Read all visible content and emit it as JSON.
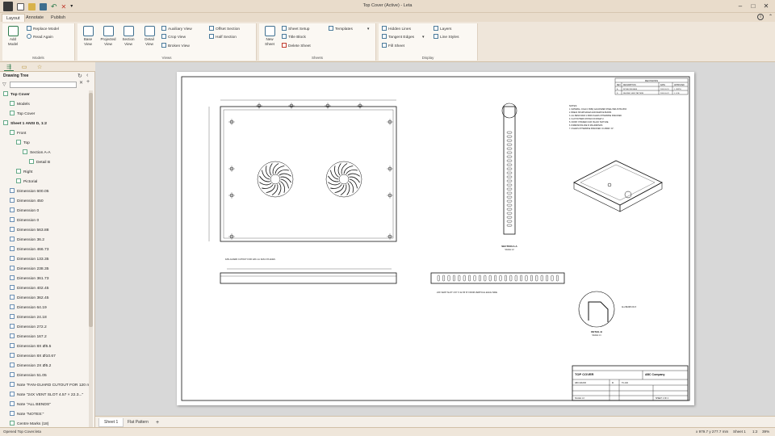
{
  "window": {
    "title": "Top Cover (Active) - Leta",
    "minimize": "–",
    "maximize": "□",
    "close": "✕"
  },
  "menu_tabs": [
    "Layout",
    "Annotate",
    "Publish"
  ],
  "ribbon": {
    "groups": {
      "models": "Models",
      "views": "Views",
      "sheets": "Sheets",
      "display": "Display"
    },
    "models": {
      "add_model": "Add\nModel",
      "replace_model": "Replace Model",
      "read_again": "Read Again"
    },
    "views": {
      "base_view": "Base\nView",
      "projected_view": "Projected\nView",
      "section_view": "Section\nView",
      "detail_view": "Detail\nView",
      "auxiliary_view": "Auxiliary View",
      "crop_view": "Crop View",
      "broken_view": "Broken View",
      "offset_section": "Offset Section",
      "half_section": "Half Section"
    },
    "sheets": {
      "new_sheet": "New\nSheet",
      "sheet_setup": "Sheet Setup",
      "title_block": "Title Block",
      "delete_sheet": "Delete Sheet",
      "templates": "Templates"
    },
    "display": {
      "hidden_lines": "Hidden Lines",
      "tangent_edges": "Tangent Edges",
      "fill_sheet": "Fill Sheet",
      "layers": "Layers",
      "line_styles": "Line Styles"
    }
  },
  "sidebar": {
    "header": "Drawing Tree",
    "tree": [
      {
        "label": "Top Cover",
        "indent": 0,
        "bold": true
      },
      {
        "label": "Models",
        "indent": 1,
        "bold": false
      },
      {
        "label": "Top Cover",
        "indent": 1,
        "bold": false
      },
      {
        "label": "Sheet 1   ANSI D, 1:2",
        "indent": 0,
        "bold": true
      },
      {
        "label": "Front",
        "indent": 1,
        "bold": false
      },
      {
        "label": "Top",
        "indent": 2,
        "bold": false
      },
      {
        "label": "Section A-A",
        "indent": 3,
        "bold": false
      },
      {
        "label": "Detail B",
        "indent": 4,
        "bold": false
      },
      {
        "label": "Right",
        "indent": 2,
        "bold": false
      },
      {
        "label": "Pictorial",
        "indent": 2,
        "bold": false
      },
      {
        "label": "Dimension 600.05",
        "indent": 1,
        "bold": false
      },
      {
        "label": "Dimension 450",
        "indent": 1,
        "bold": false
      },
      {
        "label": "Dimension 0",
        "indent": 1,
        "bold": false
      },
      {
        "label": "Dimension 0",
        "indent": 1,
        "bold": false
      },
      {
        "label": "Dimension 563.88",
        "indent": 1,
        "bold": false
      },
      {
        "label": "Dimension 36.2",
        "indent": 1,
        "bold": false
      },
      {
        "label": "Dimension 466.73",
        "indent": 1,
        "bold": false
      },
      {
        "label": "Dimension 133.35",
        "indent": 1,
        "bold": false
      },
      {
        "label": "Dimension 238.35",
        "indent": 1,
        "bold": false
      },
      {
        "label": "Dimension 361.73",
        "indent": 1,
        "bold": false
      },
      {
        "label": "Dimension 402.45",
        "indent": 1,
        "bold": false
      },
      {
        "label": "Dimension 362.45",
        "indent": 1,
        "bold": false
      },
      {
        "label": "Dimension 64.19",
        "indent": 1,
        "bold": false
      },
      {
        "label": "Dimension 24.18",
        "indent": 1,
        "bold": false
      },
      {
        "label": "Dimension 272.2",
        "indent": 1,
        "bold": false
      },
      {
        "label": "Dimension 167.2",
        "indent": 1,
        "bold": false
      },
      {
        "label": "Dimension 8X Ø5.5",
        "indent": 1,
        "bold": false
      },
      {
        "label": "Dimension 8X Ø10.67",
        "indent": 1,
        "bold": false
      },
      {
        "label": "Dimension 2X Ø5.2",
        "indent": 1,
        "bold": false
      },
      {
        "label": "Dimension 51.05",
        "indent": 1,
        "bold": false
      },
      {
        "label": "Note \"FAN-GUARD CUTOUT FOR 120 m...",
        "indent": 1,
        "bold": false
      },
      {
        "label": "Note \"24X VENT SLOT 4.57 × 22.3...\"",
        "indent": 1,
        "bold": false
      },
      {
        "label": "Note \"ALL BENDS\"",
        "indent": 1,
        "bold": false
      },
      {
        "label": "Note \"NOTES:\"",
        "indent": 1,
        "bold": false
      },
      {
        "label": "Centre Marks (18)",
        "indent": 1,
        "bold": false
      }
    ]
  },
  "drawing": {
    "revisions_title": "REVISIONS",
    "rev_headers": [
      "REV",
      "DESCRIPTION",
      "DATE",
      "APPROVED"
    ],
    "rev_rows": [
      [
        "A",
        "INITIAL RELEASE",
        "2020-10-15",
        "J. SMITH"
      ],
      [
        "B",
        "REVISED VENT PATTERN",
        "2020-10-22",
        "J. DOE"
      ]
    ],
    "notes_title": "NOTES:",
    "notes": [
      "1. MATERIAL: 16GA (1.5MM) GALVANIZED STEEL PER ASTM A653.",
      "2. BREAK SHARP EDGES AND REMOVE BURRS.",
      "3. ALL BEND RADII 1.5MM UNLESS OTHERWISE SPECIFIED.",
      "4. FLAT PATTERN SHOWN ON SHEET 2.",
      "5. FINISH: POWDER COAT, BLACK TEXTURE.",
      "6. DIMENSIONS ARE IN MILLIMETERS.",
      "7. UNLESS OTHERWISE SPECIFIED: ±0.25MM / ±1°."
    ],
    "fan_note": "FAN-GUARD CUTOUT FOR 120 mm FAN 2 PLACES",
    "vent_note": "24X VENT SLOT 4.57 X 22.35 'R' FROM VERTICAL EACH SIDE",
    "bends_note": "ALL BENDS R1.5",
    "section_label": "SECTION A-A",
    "section_scale": "SCALE 1:2",
    "detail_label": "DETAIL B",
    "detail_scale": "SCALE 1:1",
    "title_block": {
      "title": "TOP COVER",
      "company": "ABC Company",
      "drawn": "ABC MAJOR",
      "size": "D",
      "scale": "SCALE 1:2",
      "sheet": "SHEET 1 OF 2",
      "part_no": "TC-100"
    }
  },
  "sheet_tabs": [
    "Sheet 1",
    "Flat Pattern",
    "+"
  ],
  "status": {
    "left": "Opened Top Cover.leta",
    "coords": "x 979.7   y 277.7 mm",
    "sheet": "Sheet 1",
    "scale": "1:2",
    "zoom": "39%"
  }
}
